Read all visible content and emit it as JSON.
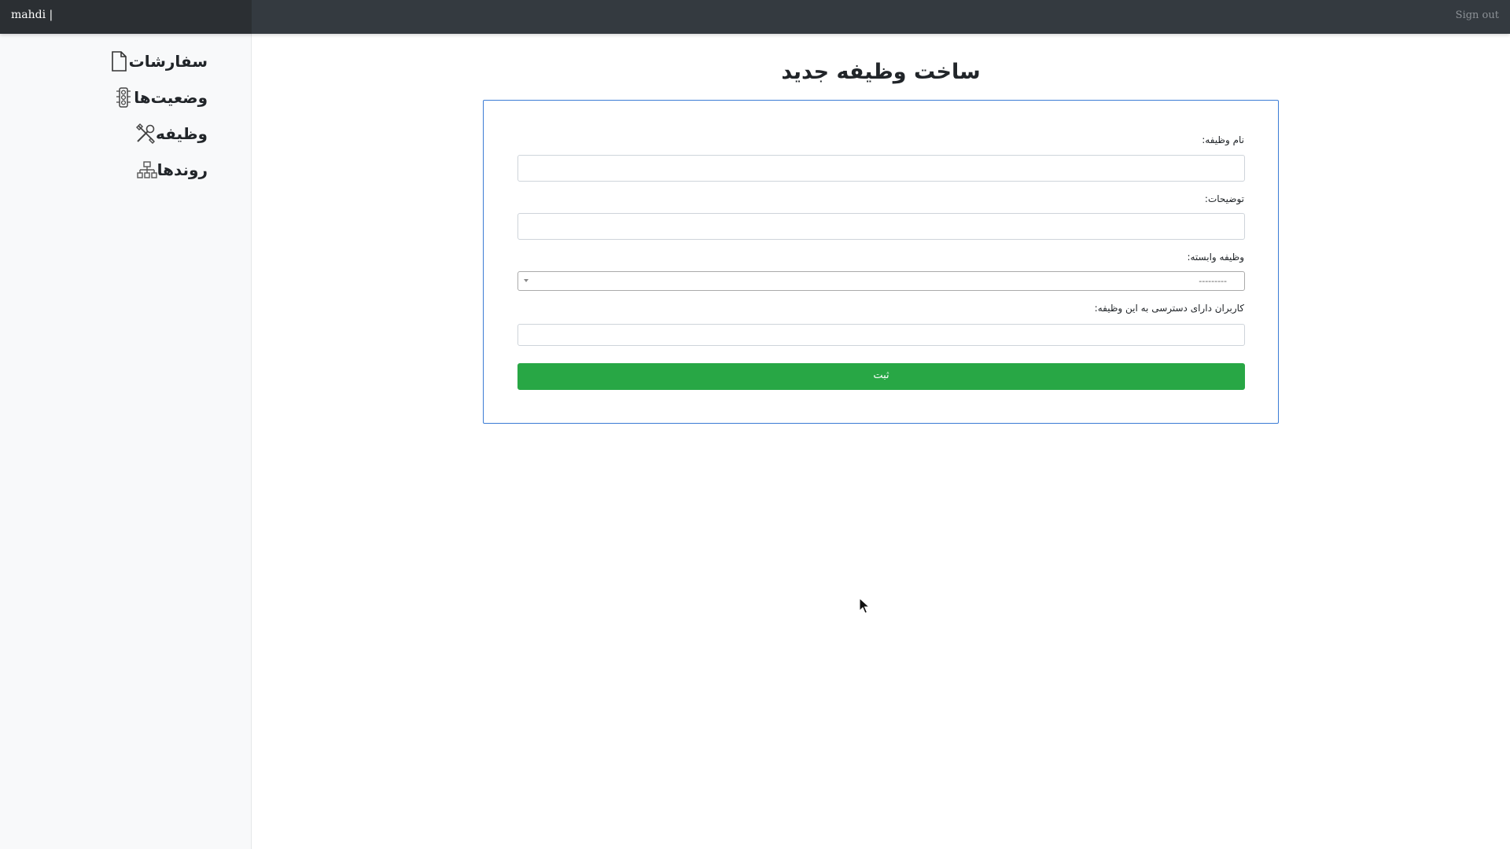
{
  "topbar": {
    "user_label": "mahdi |",
    "signout_label": "Sign out"
  },
  "sidebar": {
    "items": [
      {
        "label": "سفارشات",
        "icon": "file-icon"
      },
      {
        "label": "وضعیت‌ها",
        "icon": "traffic-light-icon"
      },
      {
        "label": "وظیفه",
        "icon": "tools-icon"
      },
      {
        "label": "روندها",
        "icon": "diagram-icon"
      }
    ]
  },
  "main": {
    "title": "ساخت وظیفه جدید",
    "form": {
      "task_name_label": "نام وظیفه:",
      "task_name_value": "",
      "description_label": "توضیحات:",
      "description_value": "",
      "dependent_task_label": "وظیفه وابسته:",
      "dependent_task_selected": "---------",
      "users_label": "کاربران دارای دسترسی به این وظیفه:",
      "users_value": "",
      "submit_label": "ثبت"
    }
  },
  "colors": {
    "navbar": "#343a40",
    "brand_bg": "#2b2f33",
    "card_border": "#3a7bd5",
    "submit": "#28a745",
    "sidebar_bg": "#f8f9fa"
  }
}
